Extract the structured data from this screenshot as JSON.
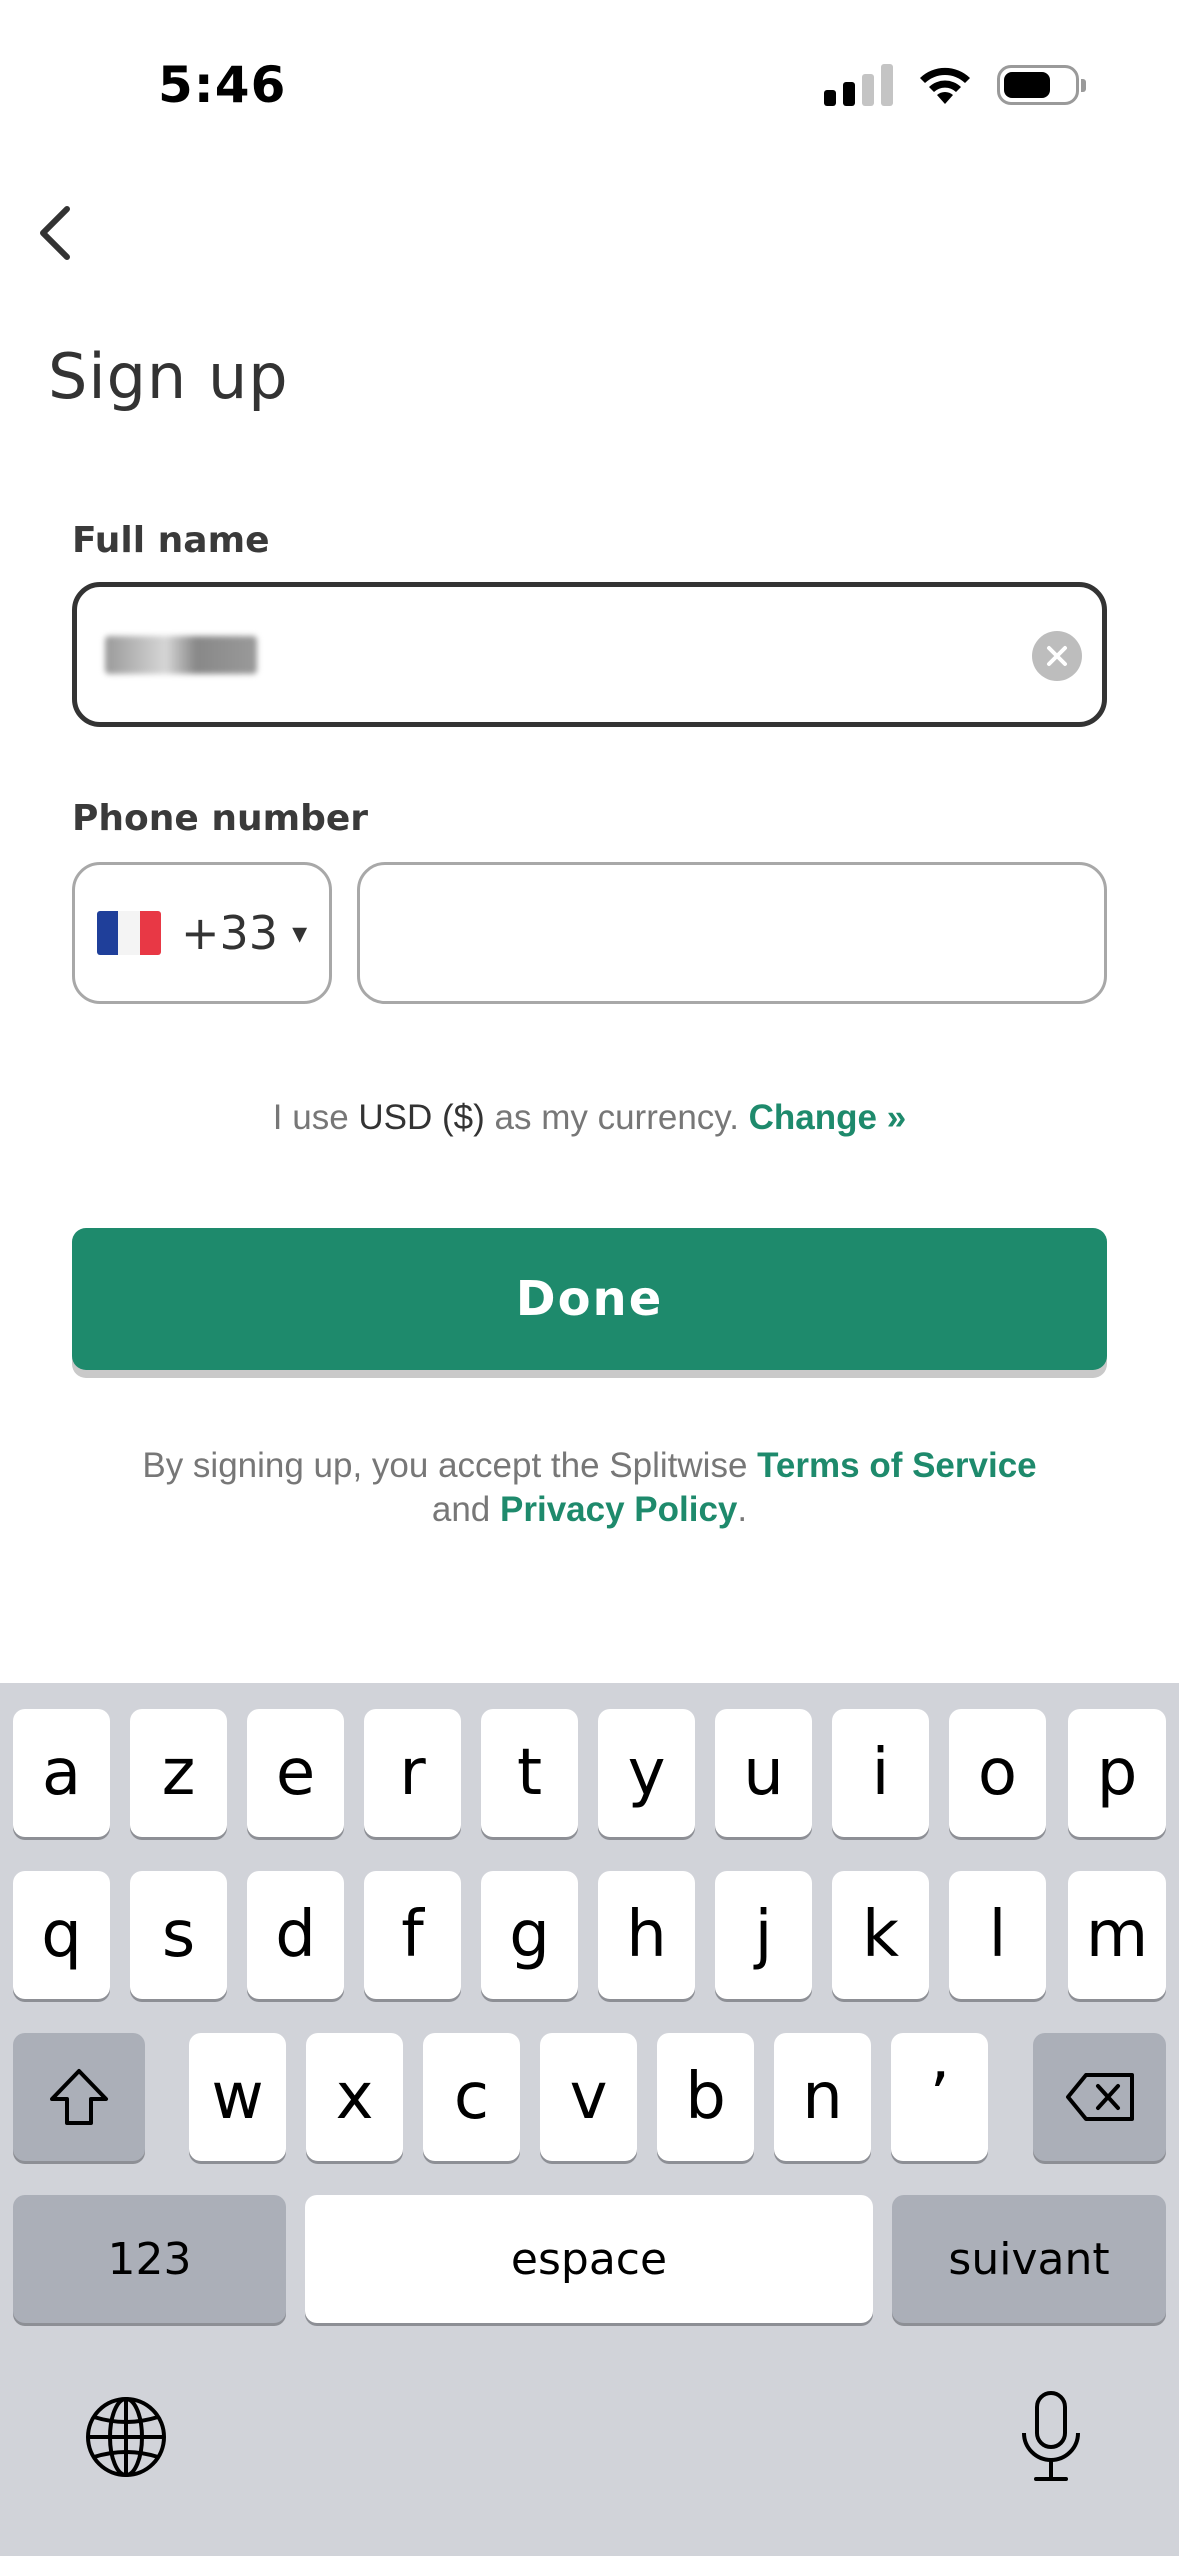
{
  "status_bar": {
    "time": "5:46"
  },
  "page": {
    "title": "Sign up"
  },
  "form": {
    "full_name_label": "Full name",
    "phone_label": "Phone number",
    "country_code": "+33",
    "caret": "▾"
  },
  "currency": {
    "prefix": "I use ",
    "currency": "USD ($)",
    "middle": " as my currency. ",
    "link": "Change »"
  },
  "done_button": "Done",
  "terms": {
    "prefix": "By signing up, you accept the Splitwise ",
    "tos": "Terms of Service",
    "middle": "and ",
    "privacy": "Privacy Policy",
    "suffix": "."
  },
  "keyboard": {
    "row1": [
      "a",
      "z",
      "e",
      "r",
      "t",
      "y",
      "u",
      "i",
      "o",
      "p"
    ],
    "row2": [
      "q",
      "s",
      "d",
      "f",
      "g",
      "h",
      "j",
      "k",
      "l",
      "m"
    ],
    "row3": [
      "w",
      "x",
      "c",
      "v",
      "b",
      "n",
      "’"
    ],
    "numbers": "123",
    "space": "espace",
    "next": "suivant"
  },
  "colors": {
    "accent": "#1e8a6c",
    "flag_blue": "#1f3f9a",
    "flag_red": "#e83845"
  }
}
